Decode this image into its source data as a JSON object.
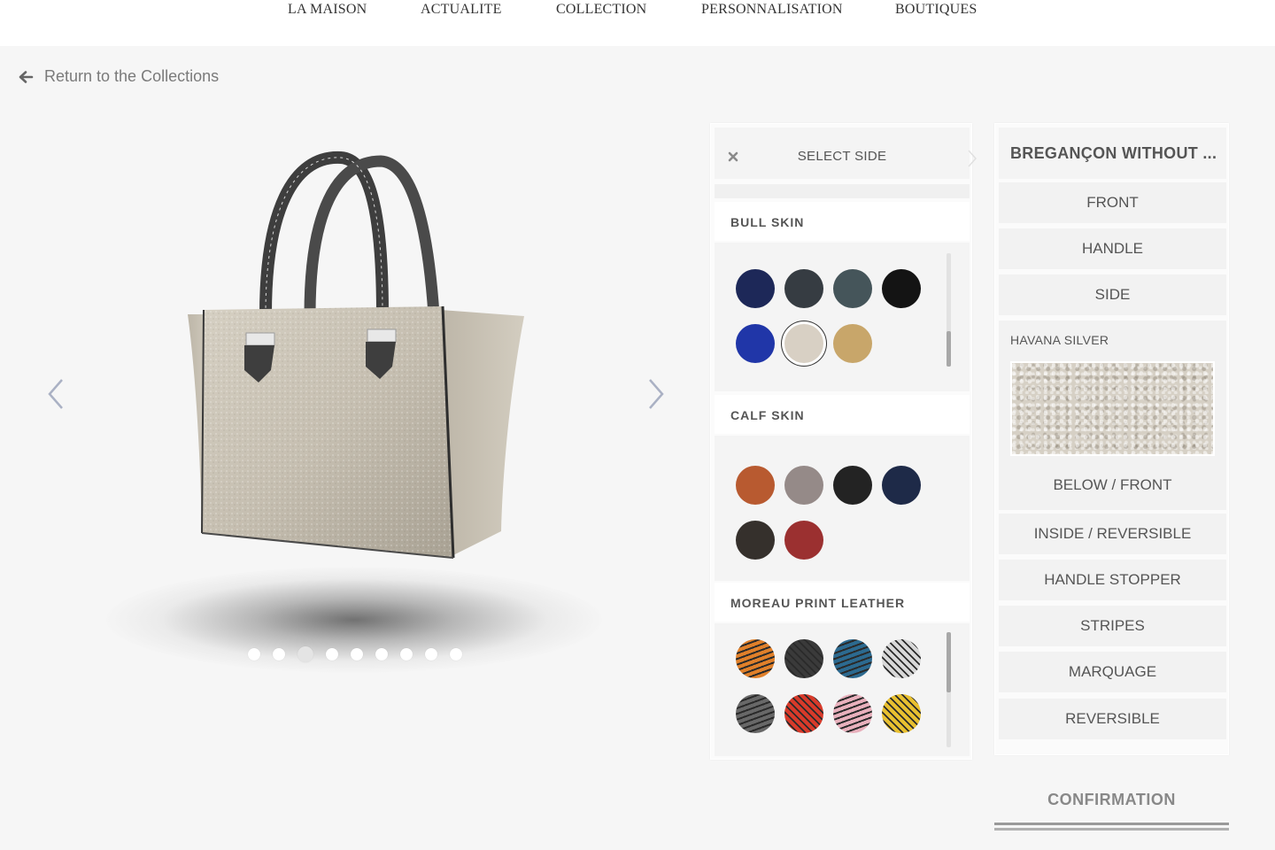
{
  "nav": {
    "items": [
      "LA MAISON",
      "ACTUALITE",
      "COLLECTION",
      "PERSONNALISATION",
      "BOUTIQUES"
    ]
  },
  "back_link": {
    "label": "Return to the Collections",
    "icon": "arrow-left-icon"
  },
  "viewer": {
    "prev_icon": "chevron-left-icon",
    "next_icon": "chevron-right-icon",
    "dot_count": 9,
    "active_dot": 3
  },
  "material_panel": {
    "select_side": "SELECT SIDE",
    "close_icon": "close-icon",
    "sections": [
      {
        "title": "BULL SKIN",
        "swatches": [
          {
            "color": "#1d2858"
          },
          {
            "color": "#363c42"
          },
          {
            "color": "#45555a"
          },
          {
            "color": "#141414"
          },
          {
            "color": "#2036a8"
          },
          {
            "color": "#d8d0c4",
            "selected": true
          },
          {
            "color": "#c8a66a"
          }
        ]
      },
      {
        "title": "CALF SKIN",
        "swatches": [
          {
            "color": "#b85a30"
          },
          {
            "color": "#958a88"
          },
          {
            "color": "#232323"
          },
          {
            "color": "#1e2a48"
          },
          {
            "color": "#35302c"
          },
          {
            "color": "#9b3030"
          }
        ]
      },
      {
        "title": "MOREAU PRINT LEATHER",
        "swatches": [
          {
            "color": "#e0802a"
          },
          {
            "color": "#3a3a3a"
          },
          {
            "color": "#2c6a90"
          },
          {
            "color": "#d8d8d8"
          },
          {
            "color": "#686868"
          },
          {
            "color": "#d83a2a"
          },
          {
            "color": "#e8b0bc"
          },
          {
            "color": "#e8c030"
          }
        ]
      }
    ]
  },
  "parts_panel": {
    "model_title": "BREGANÇON WITHOUT ...",
    "parts_top": [
      "FRONT",
      "HANDLE",
      "SIDE"
    ],
    "expanded": {
      "name": "HAVANA SILVER",
      "sub": "BELOW / FRONT"
    },
    "parts_bottom": [
      "INSIDE / REVERSIBLE",
      "HANDLE STOPPER",
      "STRIPES",
      "MARQUAGE",
      "REVERSIBLE"
    ]
  },
  "confirm": {
    "label": "CONFIRMATION"
  }
}
